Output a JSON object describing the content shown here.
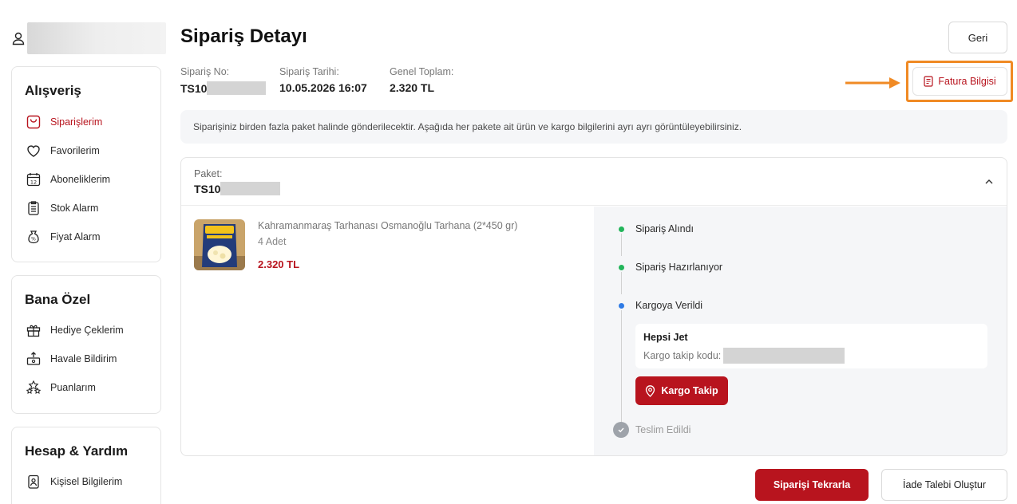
{
  "sidebar": {
    "shopping": {
      "title": "Alışveriş",
      "items": [
        {
          "label": "Siparişlerim",
          "icon": "shopping-bag-icon"
        },
        {
          "label": "Favorilerim",
          "icon": "heart-icon"
        },
        {
          "label": "Aboneliklerim",
          "icon": "calendar-icon"
        },
        {
          "label": "Stok Alarm",
          "icon": "clipboard-icon"
        },
        {
          "label": "Fiyat Alarm",
          "icon": "price-tag-icon"
        }
      ]
    },
    "special": {
      "title": "Bana Özel",
      "items": [
        {
          "label": "Hediye Çeklerim",
          "icon": "gift-icon"
        },
        {
          "label": "Havale Bildirim",
          "icon": "transfer-icon"
        },
        {
          "label": "Puanlarım",
          "icon": "stars-icon"
        }
      ]
    },
    "account": {
      "title": "Hesap & Yardım",
      "items": [
        {
          "label": "Kişisel Bilgilerim",
          "icon": "id-card-icon"
        }
      ]
    }
  },
  "page": {
    "title": "Sipariş Detayı",
    "back_label": "Geri",
    "invoice_label": "Fatura Bilgisi"
  },
  "order": {
    "no_label": "Sipariş No:",
    "no_prefix": "TS10",
    "date_label": "Sipariş Tarihi:",
    "date_value": "10.05.2026 16:07",
    "total_label": "Genel Toplam:",
    "total_value": "2.320 TL"
  },
  "notice": "Siparişiniz birden fazla paket halinde gönderilecektir. Aşağıda her pakete ait ürün ve kargo bilgilerini ayrı ayrı görüntüleyebilirsiniz.",
  "package": {
    "label": "Paket:",
    "id_prefix": "TS10",
    "product": {
      "name": "Kahramanmaraş Tarhanası Osmanoğlu Tarhana (2*450 gr)",
      "quantity": "4 Adet",
      "price": "2.320 TL"
    },
    "timeline": [
      {
        "label": "Sipariş Alındı",
        "status": "done",
        "color": "#22b55a"
      },
      {
        "label": "Sipariş Hazırlanıyor",
        "status": "done",
        "color": "#22b55a"
      },
      {
        "label": "Kargoya Verildi",
        "status": "current",
        "color": "#2f7be5"
      },
      {
        "label": "Teslim Edildi",
        "status": "pending",
        "color": "#9ea3aa"
      }
    ],
    "cargo": {
      "company": "Hepsi Jet",
      "code_label": "Kargo takip kodu:",
      "track_label": "Kargo Takip"
    }
  },
  "actions": {
    "reorder_label": "Siparişi Tekrarla",
    "return_label": "İade Talebi Oluştur"
  },
  "colors": {
    "brand": "#b8141e",
    "highlight": "#f08a24"
  }
}
